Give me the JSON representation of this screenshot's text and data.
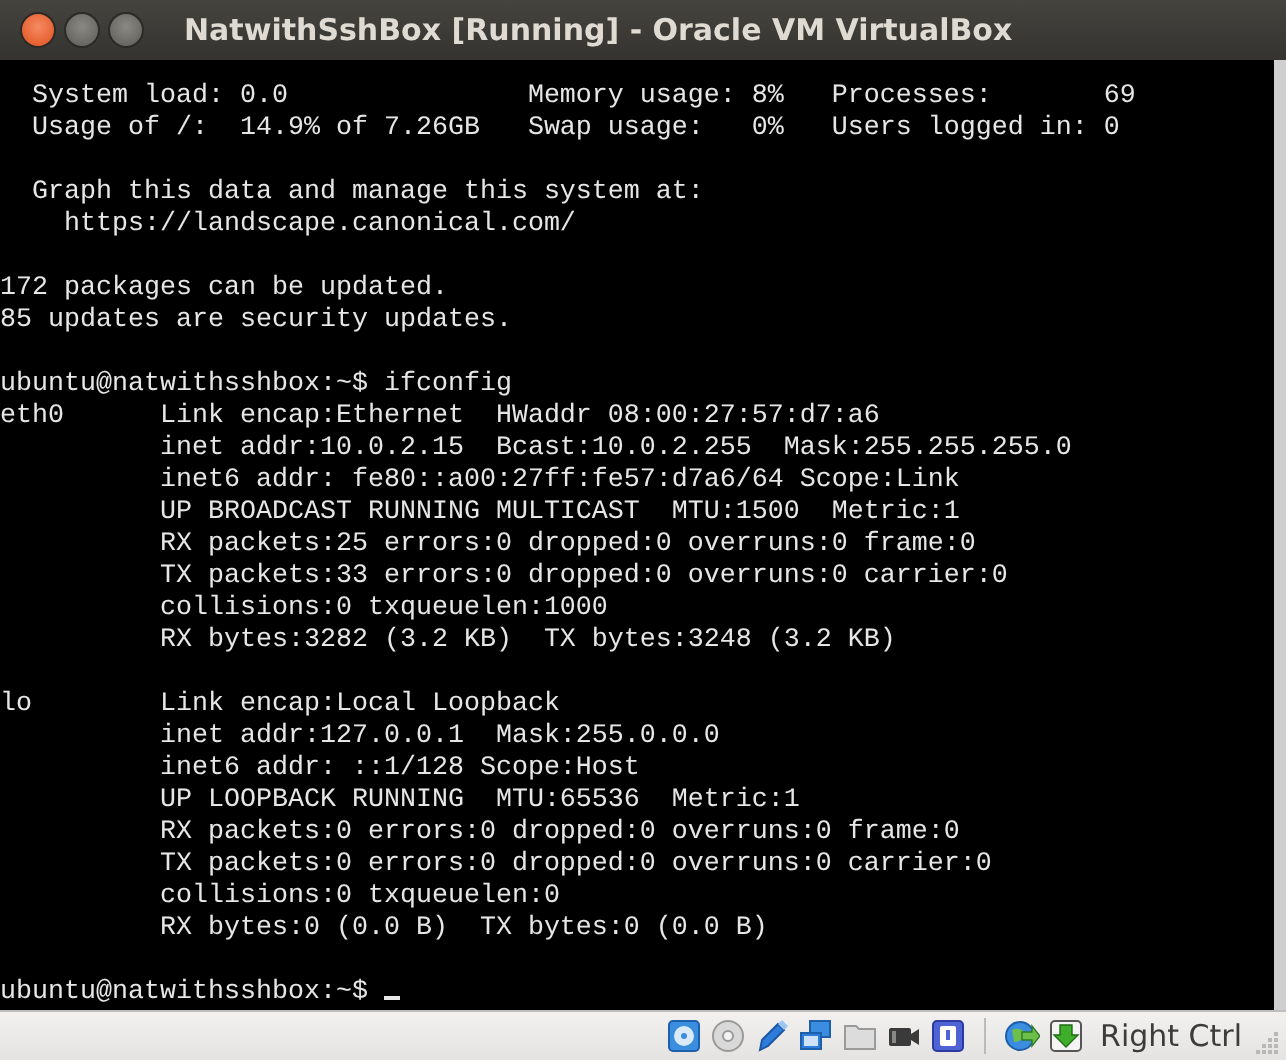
{
  "window": {
    "title": "NatwithSshBox [Running] - Oracle VM VirtualBox"
  },
  "terminal": {
    "blocks": [
      [
        "  System load: 0.0               Memory usage: 8%   Processes:       69",
        "  Usage of /:  14.9% of 7.26GB   Swap usage:   0%   Users logged in: 0"
      ],
      [
        "  Graph this data and manage this system at:",
        "    https://landscape.canonical.com/"
      ],
      [
        "172 packages can be updated.",
        "85 updates are security updates."
      ],
      [
        "ubuntu@natwithsshbox:~$ ifconfig",
        "eth0      Link encap:Ethernet  HWaddr 08:00:27:57:d7:a6",
        "          inet addr:10.0.2.15  Bcast:10.0.2.255  Mask:255.255.255.0",
        "          inet6 addr: fe80::a00:27ff:fe57:d7a6/64 Scope:Link",
        "          UP BROADCAST RUNNING MULTICAST  MTU:1500  Metric:1",
        "          RX packets:25 errors:0 dropped:0 overruns:0 frame:0",
        "          TX packets:33 errors:0 dropped:0 overruns:0 carrier:0",
        "          collisions:0 txqueuelen:1000",
        "          RX bytes:3282 (3.2 KB)  TX bytes:3248 (3.2 KB)"
      ],
      [
        "lo        Link encap:Local Loopback",
        "          inet addr:127.0.0.1  Mask:255.0.0.0",
        "          inet6 addr: ::1/128 Scope:Host",
        "          UP LOOPBACK RUNNING  MTU:65536  Metric:1",
        "          RX packets:0 errors:0 dropped:0 overruns:0 frame:0",
        "          TX packets:0 errors:0 dropped:0 overruns:0 carrier:0",
        "          collisions:0 txqueuelen:0",
        "          RX bytes:0 (0.0 B)  TX bytes:0 (0.0 B)"
      ],
      [
        "ubuntu@natwithsshbox:~$ "
      ]
    ],
    "cursor": true
  },
  "status_bar": {
    "indicators": [
      {
        "kind": "disk"
      },
      {
        "kind": "disc"
      },
      {
        "kind": "usb"
      },
      {
        "kind": "network"
      },
      {
        "kind": "folder"
      },
      {
        "kind": "camera"
      },
      {
        "kind": "chip"
      },
      {
        "kind": "separator"
      },
      {
        "kind": "mouse"
      },
      {
        "kind": "keyboard"
      }
    ],
    "host_key": "Right Ctrl"
  }
}
